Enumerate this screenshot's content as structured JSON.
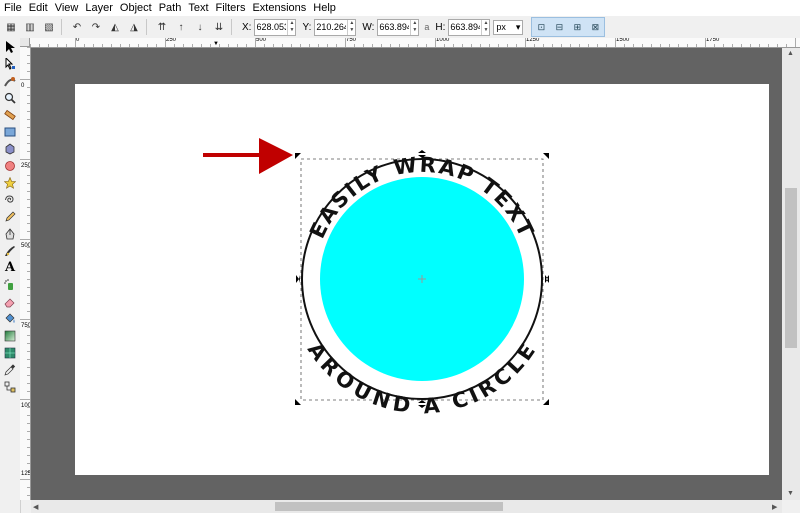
{
  "menu": [
    "File",
    "Edit",
    "View",
    "Layer",
    "Object",
    "Path",
    "Text",
    "Filters",
    "Extensions",
    "Help"
  ],
  "controls": {
    "x_label": "X:",
    "x_value": "628.053",
    "y_label": "Y:",
    "y_value": "210.264",
    "w_label": "W:",
    "w_value": "663.894",
    "h_label": "H:",
    "h_value": "663.894",
    "unit": "px"
  },
  "ruler": {
    "h_labels": [
      "0",
      "250",
      "500",
      "750",
      "1000",
      "1250",
      "1500",
      "1750"
    ],
    "v_labels": [
      "0",
      "250",
      "500",
      "750",
      "1000",
      "1250"
    ]
  },
  "artwork": {
    "text_top": "EASILY WRAP TEXT",
    "text_bottom": "AROUND A CIRCLE",
    "circle_color": "#00ffff",
    "arrow_color": "#c00000",
    "canvas_bg": "#636363"
  },
  "icons": {
    "tools": [
      "select-arrow-icon",
      "node-edit-icon",
      "tweak-icon",
      "zoom-icon",
      "measure-icon",
      "rectangle-icon",
      "box3d-icon",
      "ellipse-icon",
      "star-icon",
      "spiral-icon",
      "pencil-icon",
      "pen-icon",
      "calligraphy-icon",
      "text-icon",
      "spray-icon",
      "eraser-icon",
      "paint-bucket-icon",
      "gradient-icon",
      "mesh-icon",
      "dropper-icon",
      "connector-icon"
    ]
  }
}
